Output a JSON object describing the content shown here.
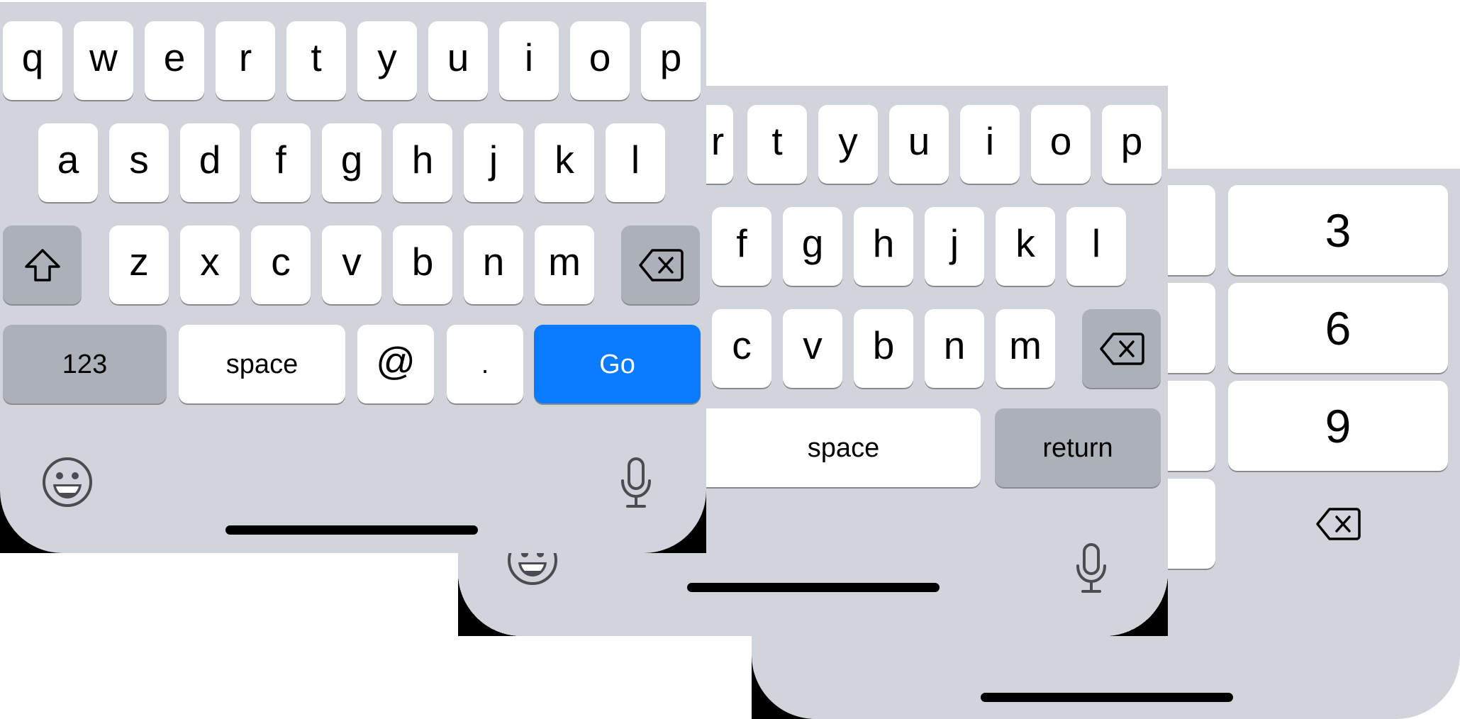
{
  "keyboard_email": {
    "row1": [
      "q",
      "w",
      "e",
      "r",
      "t",
      "y",
      "u",
      "i",
      "o",
      "p"
    ],
    "row2": [
      "a",
      "s",
      "d",
      "f",
      "g",
      "h",
      "j",
      "k",
      "l"
    ],
    "row3": [
      "z",
      "x",
      "c",
      "v",
      "b",
      "n",
      "m"
    ],
    "numbers_label": "123",
    "space_label": "space",
    "at_label": "@",
    "dot_label": ".",
    "go_label": "Go",
    "go_color": "#0a7aff"
  },
  "keyboard_default": {
    "row1": [
      "r",
      "t",
      "y",
      "u",
      "i",
      "o",
      "p"
    ],
    "row2": [
      "f",
      "g",
      "h",
      "j",
      "k",
      "l"
    ],
    "row3": [
      "c",
      "v",
      "b",
      "n",
      "m"
    ],
    "space_label": "space",
    "return_label": "return"
  },
  "keyboard_numpad": {
    "col3": [
      "3",
      "6",
      "9"
    ]
  },
  "colors": {
    "keyboard_bg": "#d1d4da",
    "key_bg": "#ffffff",
    "function_key_bg": "#acb1b9"
  },
  "icons": [
    "shift-icon",
    "delete-icon",
    "emoji-icon",
    "microphone-icon"
  ]
}
